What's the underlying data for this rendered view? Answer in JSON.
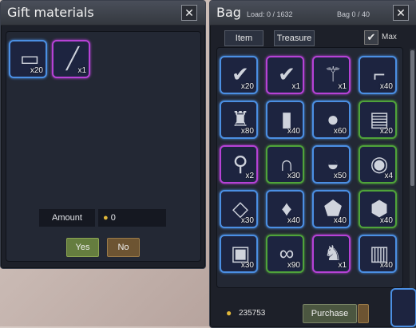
{
  "gift": {
    "title": "Gift materials",
    "close": "✕",
    "items": [
      {
        "icon": "scroll-icon",
        "glyph": "▭",
        "qty": "x20",
        "rarity": "blue"
      },
      {
        "icon": "rod-icon",
        "glyph": "╱",
        "qty": "x1",
        "rarity": "purple"
      }
    ],
    "amount_label": "Amount",
    "amount_value": "0",
    "yes_label": "Yes",
    "no_label": "No"
  },
  "bag": {
    "title": "Bag",
    "load": "Load: 0 / 1632",
    "capacity": "Bag 0 / 40",
    "close": "✕",
    "tabs": [
      "Item",
      "Treasure"
    ],
    "max_label": "Max",
    "money": "235753",
    "purchase_label": "Purchase",
    "items": [
      {
        "icon": "blue-check-coupon-icon",
        "glyph": "✔",
        "qty": "x20",
        "rarity": "blue"
      },
      {
        "icon": "purple-check-coupon-icon",
        "glyph": "✔",
        "qty": "x1",
        "rarity": "purple"
      },
      {
        "icon": "scepter-icon",
        "glyph": "⚚",
        "qty": "x1",
        "rarity": "purple"
      },
      {
        "icon": "boot-icon",
        "glyph": "⌐",
        "qty": "x40",
        "rarity": "blue"
      },
      {
        "icon": "armor-figure-icon",
        "glyph": "♜",
        "qty": "x80",
        "rarity": "blue"
      },
      {
        "icon": "candle-icon",
        "glyph": "▮",
        "qty": "x40",
        "rarity": "blue"
      },
      {
        "icon": "crystal-ball-icon",
        "glyph": "●",
        "qty": "x60",
        "rarity": "blue"
      },
      {
        "icon": "book-stack-icon",
        "glyph": "▤",
        "qty": "x20",
        "rarity": "green"
      },
      {
        "icon": "wand-icon",
        "glyph": "⚲",
        "qty": "x2",
        "rarity": "purple"
      },
      {
        "icon": "magnet-icon",
        "glyph": "∩",
        "qty": "x30",
        "rarity": "green"
      },
      {
        "icon": "gold-bowl-icon",
        "glyph": "◒",
        "qty": "x50",
        "rarity": "blue"
      },
      {
        "icon": "red-orb-icon",
        "glyph": "◉",
        "qty": "x4",
        "rarity": "green"
      },
      {
        "icon": "pillow-icon",
        "glyph": "◇",
        "qty": "x30",
        "rarity": "blue"
      },
      {
        "icon": "pouch-icon",
        "glyph": "♦",
        "qty": "x40",
        "rarity": "blue"
      },
      {
        "icon": "ore-icon",
        "glyph": "⬟",
        "qty": "x40",
        "rarity": "blue"
      },
      {
        "icon": "red-gem-icon",
        "glyph": "⬢",
        "qty": "x40",
        "rarity": "green"
      },
      {
        "icon": "device-icon",
        "glyph": "▣",
        "qty": "x30",
        "rarity": "blue"
      },
      {
        "icon": "goggles-icon",
        "glyph": "∞",
        "qty": "x90",
        "rarity": "green"
      },
      {
        "icon": "boots-icon",
        "glyph": "♞",
        "qty": "x1",
        "rarity": "purple"
      },
      {
        "icon": "red-box-icon",
        "glyph": "▥",
        "qty": "x40",
        "rarity": "blue"
      }
    ]
  }
}
